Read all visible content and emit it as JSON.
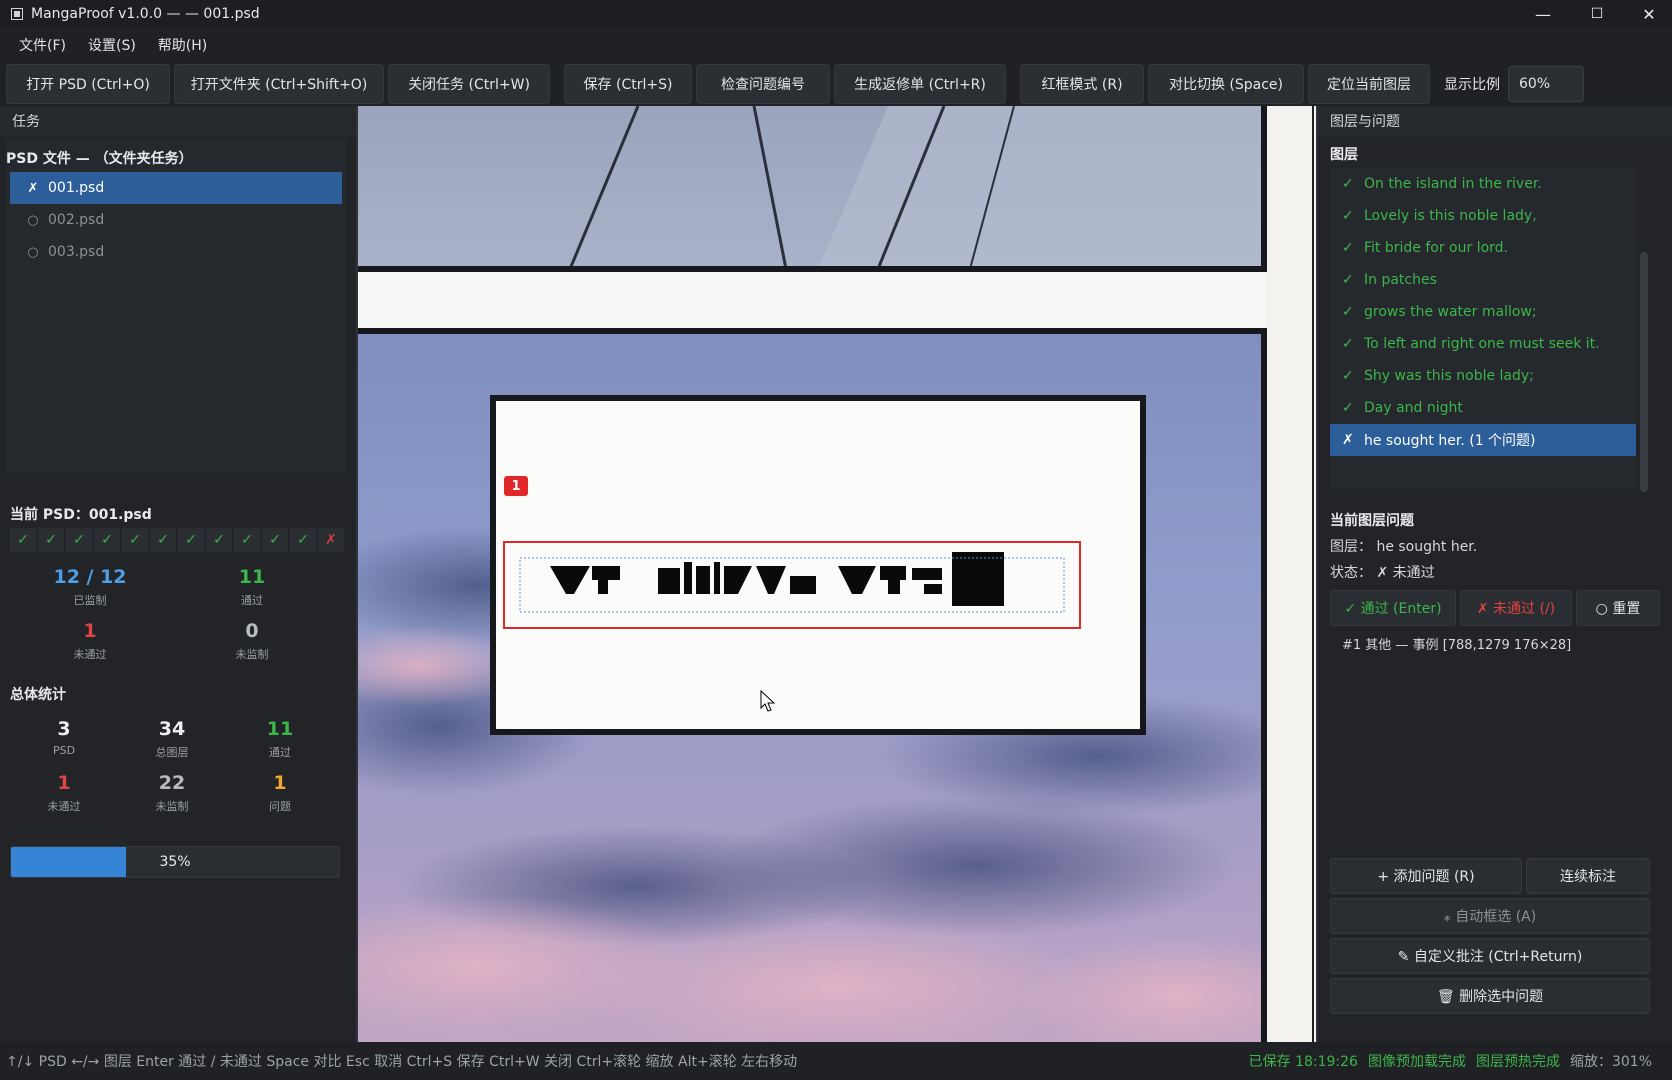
{
  "window": {
    "title": "MangaProof v1.0.0 — — 001.psd",
    "minimize": "—",
    "maximize": "☐",
    "close": "✕"
  },
  "menu": [
    "文件(F)",
    "设置(S)",
    "帮助(H)"
  ],
  "toolbar": {
    "open_psd": "打开 PSD (Ctrl+O)",
    "open_folder": "打开文件夹 (Ctrl+Shift+O)",
    "close_task": "关闭任务 (Ctrl+W)",
    "save": "保存 (Ctrl+S)",
    "check_ids": "检查问题编号",
    "gen_report": "生成返修单 (Ctrl+R)",
    "red_frame": "红框模式 (R)",
    "compare": "对比切换 (Space)",
    "locate_layer": "定位当前图层",
    "zoom_label": "显示比例",
    "zoom_value": "60%"
  },
  "left": {
    "header": "任务",
    "files_title": "PSD 文件 — （文件夹任务）",
    "files": [
      {
        "icon": "✗",
        "name": "001.psd",
        "selected": true
      },
      {
        "icon": "○",
        "name": "002.psd",
        "selected": false
      },
      {
        "icon": "○",
        "name": "003.psd",
        "selected": false
      }
    ],
    "current_title": "当前 PSD：001.psd",
    "checks": [
      "✓",
      "✓",
      "✓",
      "✓",
      "✓",
      "✓",
      "✓",
      "✓",
      "✓",
      "✓",
      "✓",
      "✗"
    ],
    "current_stats": {
      "reviewed": {
        "num": "12 / 12",
        "label": "已监制"
      },
      "passed": {
        "num": "11",
        "label": "通过"
      },
      "failed": {
        "num": "1",
        "label": "未通过"
      },
      "unreviewed": {
        "num": "0",
        "label": "未监制"
      }
    },
    "overall_title": "总体统计",
    "overall": {
      "psd": {
        "num": "3",
        "label": "PSD"
      },
      "layers": {
        "num": "34",
        "label": "总图层"
      },
      "passed": {
        "num": "11",
        "label": "通过"
      },
      "failed": {
        "num": "1",
        "label": "未通过"
      },
      "unreviewed": {
        "num": "22",
        "label": "未监制"
      },
      "issues": {
        "num": "1",
        "label": "问题"
      }
    },
    "progress": {
      "value": 0.35,
      "text": "35%"
    }
  },
  "canvas": {
    "issue_badge": "1"
  },
  "right": {
    "header": "图层与问题",
    "layers_title": "图层",
    "layers": [
      {
        "icon": "✓",
        "text": "On the island  in the river.",
        "selected": false
      },
      {
        "icon": "✓",
        "text": "Lovely is this  noble lady,",
        "selected": false
      },
      {
        "icon": "✓",
        "text": "Fit bride  for our lord.",
        "selected": false
      },
      {
        "icon": "✓",
        "text": "In patches",
        "selected": false
      },
      {
        "icon": "✓",
        "text": "grows the  water mallow;",
        "selected": false
      },
      {
        "icon": "✓",
        "text": "To left and right  one must seek it.",
        "selected": false
      },
      {
        "icon": "✓",
        "text": "Shy was  this noble lady;",
        "selected": false
      },
      {
        "icon": "✓",
        "text": "Day and night",
        "selected": false
      },
      {
        "icon": "✗",
        "text": "he sought her.  (1 个问题)",
        "selected": true
      }
    ],
    "issue_title": "当前图层问题",
    "layer_line": "图层：  he sought her.",
    "status_line": "状态：  ✗  未通过",
    "pass_btn": "✓  通过 (Enter)",
    "fail_btn": "✗  未通过 (/)",
    "reset_btn": "○  重置",
    "issue_item": "#1 其他 — 事例    [788,1279 176×28]",
    "add_issue": "+  添加问题 (R)",
    "continuous": "连续标注",
    "auto_select": "⁎ 自动框选 (A)",
    "custom_note": "✎  自定义批注 (Ctrl+Return)",
    "delete_issue": "🗑  删除选中问题"
  },
  "status": {
    "hints": "↑/↓ PSD   ←/→ 图层   Enter 通过   / 未通过   Space 对比   Esc 取消   Ctrl+S 保存   Ctrl+W 关闭   Ctrl+滚轮 缩放   Alt+滚轮 左右移动",
    "saved": "已保存 18:19:26",
    "preload": "图像预加载完成",
    "prewarm": "图层预热完成",
    "zoom": "缩放：301%"
  }
}
